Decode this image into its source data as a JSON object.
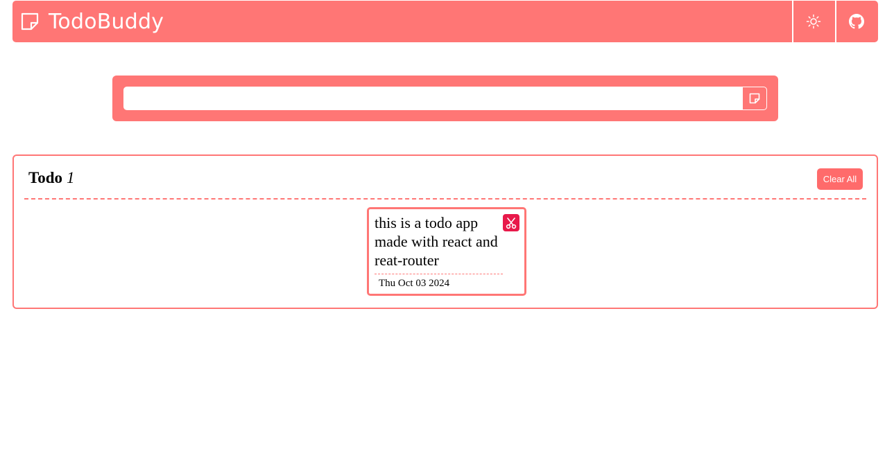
{
  "app": {
    "title": "TodoBuddy"
  },
  "header": {
    "icons": {
      "brand": "sticky-note-icon",
      "theme_toggle": "sun-icon",
      "github": "github-icon"
    }
  },
  "input": {
    "value": "",
    "placeholder": "",
    "add_icon": "sticky-note-icon"
  },
  "todo_panel": {
    "title": "Todo",
    "count": "1",
    "clear_all_label": "Clear All",
    "items": [
      {
        "text": "this is a todo app made with react and reat-router",
        "date": "Thu Oct 03 2024",
        "delete_icon": "scissors-icon"
      }
    ]
  },
  "colors": {
    "primary": "#ff7675",
    "danger": "#e8194a",
    "button": "#ff6b6b",
    "text": "#000000",
    "background": "#ffffff"
  }
}
